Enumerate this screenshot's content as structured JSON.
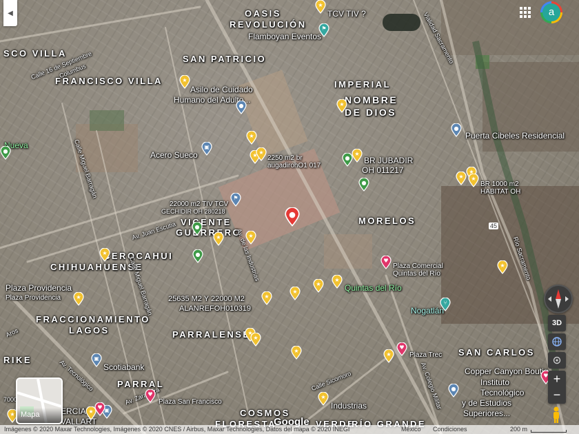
{
  "map": {
    "type": "satellite",
    "style": "aerial"
  },
  "neighborhoods": {
    "oasis": "OASIS",
    "revolucion": "REVOLUCIÓN",
    "sco_villa": "SCO VILLA",
    "francisco_villa": "FRANCISCO VILLA",
    "san_patricio": "SAN PATRICIO",
    "imperial": "IMPERIAL",
    "nombre": "NOMBRE",
    "de_dios": "DE DIOS",
    "morelos": "MORELOS",
    "vicente": "VICENTE",
    "guerrero": "GUERRERO",
    "cerocahui": "CEROCAHUI",
    "chihuahuense": "CHIHUAHUENSE",
    "fraccionamiento": "FRACCIONAMIENTO",
    "lagos": "LAGOS",
    "parralense": "PARRALENSE",
    "san_carlos": "SAN CARLOS",
    "parral": "PARRAL",
    "rike": "RIKE",
    "cosmos": "COSMOS",
    "floresta": "FLORESTA",
    "verde": "VERDE",
    "rio_grande": "RÍO GRANDE"
  },
  "pois": {
    "tcv": "TCV TIV ?",
    "flamboyan": "Flamboyan Eventos",
    "asilo_1": "Asilo de Cuidado",
    "asilo_2": "Humano del Adulto...",
    "acero": "Acero Sueco",
    "m2250_1": "2250 m2 br",
    "m2250_2": "augadirohO1 017",
    "br_jubadir_1": "BR JUBADIR",
    "br_jubadir_2": "OH 011217",
    "puerta": "Puerta Cibeles Residencial",
    "br1000_1": "BR 1000 m2",
    "br1000_2": "HABITAT OH",
    "m22000_1": "22000 m2 TIV TCV",
    "m22000_2": "GECHIDIR OH 280218",
    "plaza_comercial_1": "Plaza Comercial",
    "plaza_comercial_2": "Quintas del Río",
    "quintas": "Quintas del Río",
    "plaza_providencia_1": "Plaza Providencia",
    "plaza_providencia_2": "Plaza Providencia",
    "m25635_1": "25635 M2  Y 22000 M2",
    "m25635_2": "ALANREFOH010319",
    "nogatlan": "Nogatlán",
    "plaza_trec": "Plaza Trec",
    "scotiabank": "Scotiabank",
    "copper": "Copper Canyon Boutiq",
    "instituto_1": "Instituto",
    "instituto_2": "Tecnológico",
    "instituto_3": "y de Estudios",
    "instituto_4": "Superiores...",
    "plaza_sf": "Plaza San Francisco",
    "industrias": "Industrias",
    "nueva": "Nueva",
    "vallart": "VALLART",
    "ercial": "ERCIAL"
  },
  "streets": {
    "calle16": "Calle 16 de Septiembre",
    "columbus": "Columbus",
    "miguel_barragan": "Calle Miguel Barragán",
    "juan_escutia": "Av. Juan Escutia",
    "industrias_av": "Av. de las Industrias",
    "miguel_barragan2": "Calle Miguel Barragán",
    "tecnologico": "Av. Tecnológico",
    "zaragoza": "Av. Zaragoza",
    "sicomoro": "Calle Sicomoro",
    "colegio_militar": "Av. Colegio Militar",
    "vialidad": "Vialidad Sacramento",
    "rio_sacramento": "Río Sacramento",
    "aros": "Aros",
    "route45": "45",
    "hundred": "7000"
  },
  "ui": {
    "account_initial": "a",
    "btn_3d": "3D",
    "zoom_in": "+",
    "zoom_out": "−",
    "minimap_label": "Mapa",
    "google": "Google"
  },
  "footer": {
    "attribution": "Imágenes © 2020 Maxar Technologies, Imágenes © 2020 CNES / Airbus, Maxar Technologies, Datos del mapa © 2020 INEGI",
    "country": "México",
    "conditions": "Condiciones",
    "scale": "200 m"
  },
  "colors": {
    "yellow_pin": "#f2c230",
    "blue_pin": "#5c86b3",
    "green_pin": "#3e9a47",
    "pink_pin": "#e0356a",
    "red_pin": "#e53935",
    "teal_pin": "#35a8a0"
  }
}
